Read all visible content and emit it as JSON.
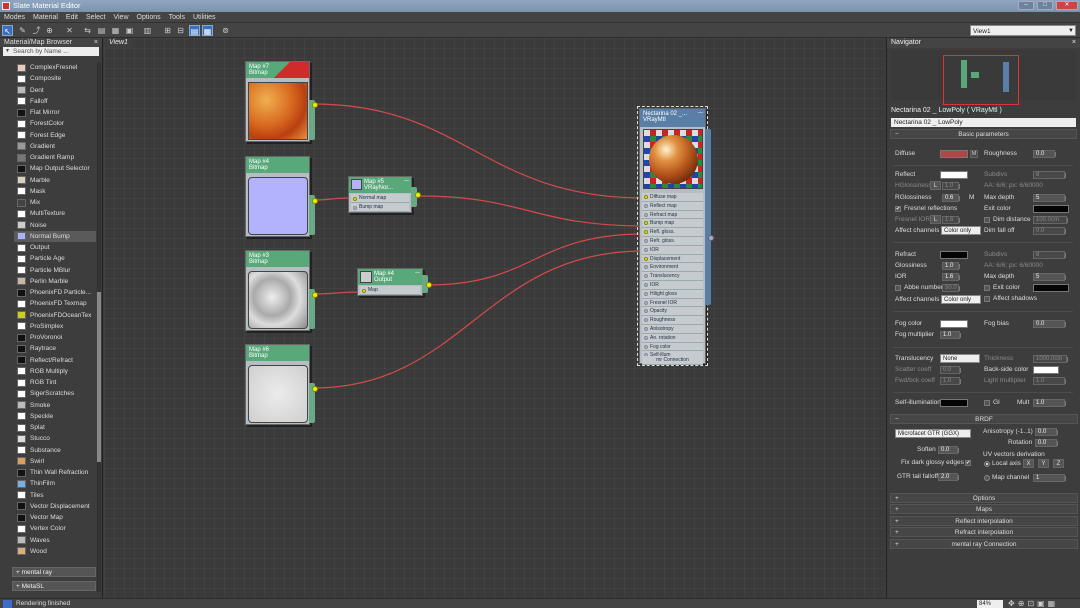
{
  "window": {
    "title": "Slate Material Editor"
  },
  "menu": [
    "Modes",
    "Material",
    "Edit",
    "Select",
    "View",
    "Options",
    "Tools",
    "Utilities"
  ],
  "toolbar": {
    "view_dropdown": "View1"
  },
  "browser": {
    "title": "Material/Map Browser",
    "title_close": "×",
    "search_placeholder": "Search by Name ...",
    "items": [
      {
        "label": "ComplexFresnel",
        "color": "#e9c9c0"
      },
      {
        "label": "Composite",
        "color": "#ffffff"
      },
      {
        "label": "Dent",
        "color": "#bbbbbb"
      },
      {
        "label": "Falloff",
        "color": "#ffffff"
      },
      {
        "label": "Flat Mirror",
        "color": "#111111"
      },
      {
        "label": "ForestColor",
        "color": "#ffffff"
      },
      {
        "label": "Forest Edge",
        "color": "#ffffff"
      },
      {
        "label": "Gradient",
        "color": "#999999"
      },
      {
        "label": "Gradient Ramp",
        "color": "#777777"
      },
      {
        "label": "Map Output Selector",
        "color": "#111111"
      },
      {
        "label": "Marble",
        "color": "#d8d0c0"
      },
      {
        "label": "Mask",
        "color": "#ffffff"
      },
      {
        "label": "Mix",
        "color": "#444444"
      },
      {
        "label": "MultiTexture",
        "color": "#ffffff"
      },
      {
        "label": "Noise",
        "color": "#cccccc"
      },
      {
        "label": "Normal Bump",
        "color": "#aab3ff"
      },
      {
        "label": "Output",
        "color": "#ffffff"
      },
      {
        "label": "Particle Age",
        "color": "#ffffff"
      },
      {
        "label": "Particle MBlur",
        "color": "#ffffff"
      },
      {
        "label": "Perlin Marble",
        "color": "#c8b7a6"
      },
      {
        "label": "PhoenixFD Particle...",
        "color": "#111111"
      },
      {
        "label": "PhoenixFD Texmap",
        "color": "#ffffff"
      },
      {
        "label": "PhoenixFDOceanTex",
        "color": "#cccc22"
      },
      {
        "label": "ProSimplex",
        "color": "#ffffff"
      },
      {
        "label": "ProVoronoi",
        "color": "#111111"
      },
      {
        "label": "Raytrace",
        "color": "#111111"
      },
      {
        "label": "Reflect/Refract",
        "color": "#111111"
      },
      {
        "label": "RGB Multiply",
        "color": "#ffffff"
      },
      {
        "label": "RGB Tint",
        "color": "#ffffff"
      },
      {
        "label": "SigerScratches",
        "color": "#ffffff"
      },
      {
        "label": "Smoke",
        "color": "#bbbbbb"
      },
      {
        "label": "Speckle",
        "color": "#ffffff"
      },
      {
        "label": "Splat",
        "color": "#ffffff"
      },
      {
        "label": "Stucco",
        "color": "#dddddd"
      },
      {
        "label": "Substance",
        "color": "#ffffff"
      },
      {
        "label": "Swirl",
        "color": "#d8a060"
      },
      {
        "label": "Thin Wall Refraction",
        "color": "#111111"
      },
      {
        "label": "ThinFilm",
        "color": "#7ab0e0"
      },
      {
        "label": "Tiles",
        "color": "#ffffff"
      },
      {
        "label": "Vector Displacement",
        "color": "#111111"
      },
      {
        "label": "Vector Map",
        "color": "#111111"
      },
      {
        "label": "Vertex Color",
        "color": "#ffffff"
      },
      {
        "label": "Waves",
        "color": "#bbbbbb"
      },
      {
        "label": "Wood",
        "color": "#d8b080"
      }
    ],
    "rollouts": [
      "+ mental ray",
      "+ MetaSL"
    ]
  },
  "view": {
    "tab": "View1"
  },
  "nodes": {
    "map7": {
      "title": "Map #7",
      "type": "Bitmap"
    },
    "map4": {
      "title": "Map #4",
      "type": "Bitmap"
    },
    "map3": {
      "title": "Map #3",
      "type": "Bitmap"
    },
    "map6": {
      "title": "Map #6",
      "type": "Bitmap"
    },
    "map5": {
      "title": "Map #5",
      "type": "VRayNor...",
      "slots": [
        "Normal map",
        "Bump map"
      ]
    },
    "output": {
      "title": "Map #4",
      "type": "Output",
      "slots": [
        "Map"
      ]
    },
    "material": {
      "title": "Nectarina 02 _...",
      "type": "VRayMtl",
      "slots": [
        "Diffuse map",
        "Reflect map",
        "Refract map",
        "Bump map",
        "Refl. gloss.",
        "Refr. gloss.",
        "IOR",
        "Displacement",
        "Environment",
        "Translucency",
        "IOR",
        "Hilight gloss",
        "Fresnel IOR",
        "Opacity",
        "Roughness",
        "Anisotropy",
        "An. rotation",
        "Fog color",
        "Self-illum"
      ],
      "footer": "mr Connection"
    }
  },
  "navigator": {
    "title": "Navigator",
    "close": "×"
  },
  "params": {
    "header": "Nectarina 02 _ LowPoly  ( VRayMtl )",
    "name_field": "Nectarina 02 _ LowPoly",
    "basic_title": "Basic parameters",
    "diffuse": {
      "label": "Diffuse",
      "color": "#b04646",
      "m": "M",
      "roughness_label": "Roughness",
      "roughness": "0.0"
    },
    "reflect": {
      "label": "Reflect",
      "color": "#ffffff",
      "subdivs_label": "Subdivs",
      "subdivs": "8",
      "hgloss_label": "HGlossiness",
      "hgloss_l": "L",
      "hgloss": "1.0",
      "aa_label": "AA: 6/6; px: 6/60000",
      "rgloss_label": "RGlossiness",
      "rgloss": "0.6",
      "rgloss_m": "M",
      "maxdepth_label": "Max depth",
      "maxdepth": "5",
      "fresnel_label": "Fresnel reflections",
      "fresnel_check": "✔",
      "exit_label": "Exit color",
      "fior_label": "Fresnel IOR",
      "fior_l": "L",
      "fior": "1.6",
      "dim_label": "Dim distance",
      "dim": "100.0cm",
      "affect_label": "Affect channels",
      "affect": "Color only",
      "dimfall_label": "Dim fall off",
      "dimfall": "0.0"
    },
    "refract": {
      "label": "Refract",
      "color": "#050505",
      "subdivs_label": "Subdivs",
      "subdivs": "8",
      "gloss_label": "Glossiness",
      "gloss": "1.0",
      "aa_label": "AA: 6/6; px: 6/60000",
      "ior_label": "IOR",
      "ior": "1.6",
      "maxdepth_label": "Max depth",
      "maxdepth": "5",
      "abbe_label": "Abbe number",
      "abbe": "50.0",
      "exit_label": "Exit color",
      "affect_label": "Affect channels",
      "affect": "Color only",
      "shadows_label": "Affect shadows"
    },
    "fog": {
      "color_label": "Fog color",
      "color": "#ffffff",
      "bias_label": "Fog bias",
      "bias": "0.0",
      "mult_label": "Fog multiplier",
      "mult": "1.0"
    },
    "translucency": {
      "label": "Translucency",
      "value": "None",
      "thickness_label": "Thickness",
      "thickness": "1000.0cm",
      "scatter_label": "Scatter coeff",
      "scatter": "0.0",
      "backside_label": "Back-side color",
      "fwd_label": "Fwd/bck coeff",
      "fwd": "1.0",
      "light_label": "Light multiplier",
      "light": "1.0"
    },
    "selfillum": {
      "label": "Self-illumination",
      "gi_label": "GI",
      "mult_label": "Mult",
      "mult": "1.0"
    },
    "brdf": {
      "title": "BRDF",
      "type": "Microfacet GTR (GGX)",
      "aniso_label": "Anisotropy (-1..1)",
      "aniso": "0.0",
      "rotation_label": "Rotation",
      "rotation": "0.0",
      "soften_label": "Soften",
      "soften": "0.0",
      "uv_label": "UV vectors derivation",
      "fixdark_label": "Fix dark glossy edges",
      "fixdark_check": "✔",
      "local_label": "Local axis",
      "x": "X",
      "y": "Y",
      "z": "Z",
      "gtr_label": "GTR tail falloff",
      "gtr": "2.0",
      "mapch_label": "Map channel",
      "mapch": "1"
    },
    "collapsed": [
      "Options",
      "Maps",
      "Reflect interpolation",
      "Refract interpolation",
      "mental ray Connection"
    ]
  },
  "status": {
    "text": "Rendering finished",
    "zoom": "84%"
  }
}
